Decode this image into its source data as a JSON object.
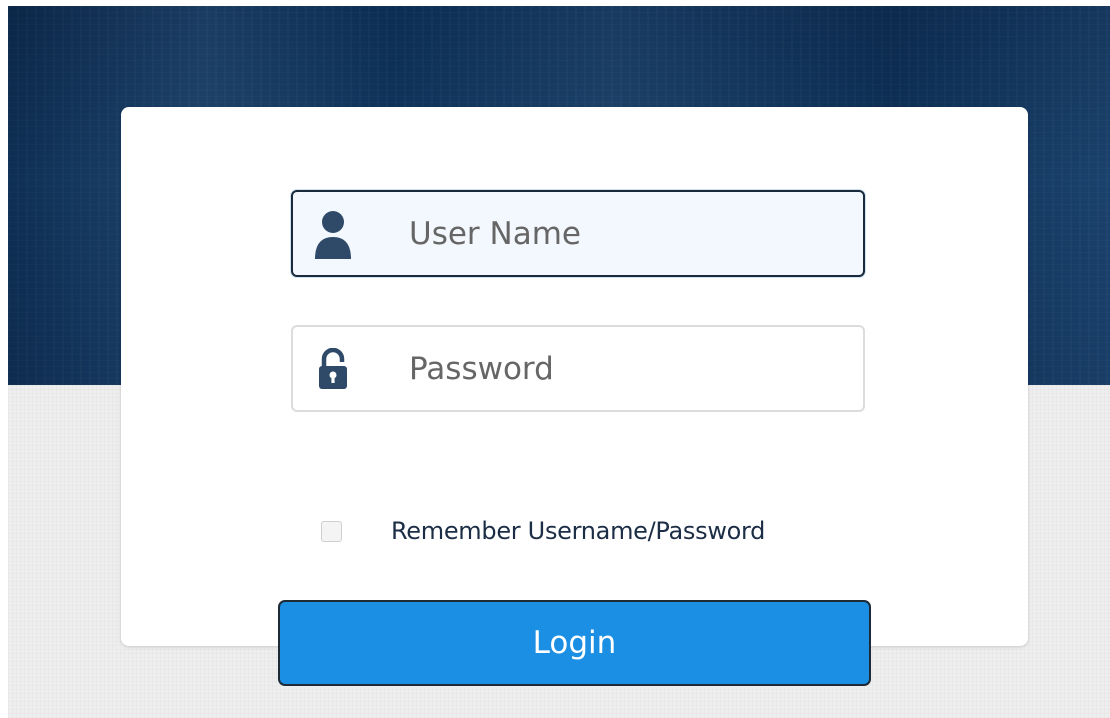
{
  "login_form": {
    "username": {
      "placeholder": "User Name",
      "value": "",
      "icon": "user-icon"
    },
    "password": {
      "placeholder": "Password",
      "value": "",
      "icon": "unlock-icon"
    },
    "remember_label": "Remember Username/Password",
    "remember_checked": false,
    "login_label": "Login"
  },
  "colors": {
    "header_bg": "#0f3560",
    "page_bg": "#eeeeee",
    "icon": "#2f4a68",
    "button_bg": "#1a8fe3",
    "label_text": "#1c2e45"
  }
}
